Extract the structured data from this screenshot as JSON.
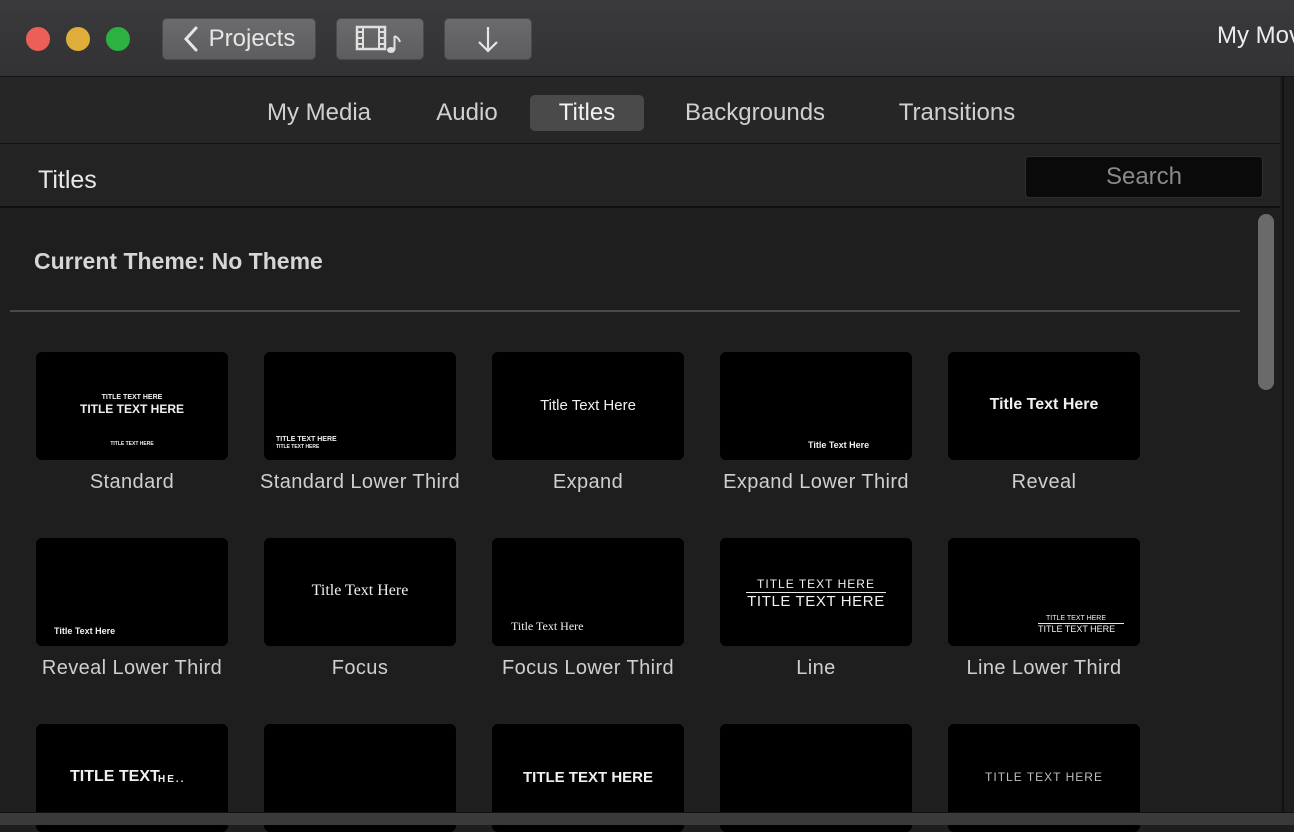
{
  "window": {
    "title": "My Mov"
  },
  "toolbar": {
    "projects_label": "Projects",
    "media_button_icon": "film-music-icon",
    "import_button_icon": "down-arrow-icon"
  },
  "tabs": [
    {
      "label": "My Media"
    },
    {
      "label": "Audio"
    },
    {
      "label": "Titles",
      "active": true
    },
    {
      "label": "Backgrounds"
    },
    {
      "label": "Transitions"
    }
  ],
  "section": {
    "title": "Titles",
    "search_placeholder": "Search"
  },
  "theme": {
    "label": "Current Theme: No Theme"
  },
  "tiles": [
    {
      "label": "Standard",
      "preview": [
        "TITLE TEXT HERE",
        "TITLE TEXT HERE",
        "TITLE TEXT HERE"
      ]
    },
    {
      "label": "Standard Lower Third",
      "preview": [
        "TITLE TEXT HERE",
        "TITLE TEXT HERE"
      ]
    },
    {
      "label": "Expand",
      "preview": [
        "Title Text Here"
      ]
    },
    {
      "label": "Expand Lower Third",
      "preview": [
        "Title Text Here"
      ]
    },
    {
      "label": "Reveal",
      "preview": [
        "Title Text Here"
      ]
    },
    {
      "label": "Reveal Lower Third",
      "preview": [
        "Title Text Here"
      ]
    },
    {
      "label": "Focus",
      "preview": [
        "Title Text Here"
      ]
    },
    {
      "label": "Focus Lower Third",
      "preview": [
        "Title Text Here"
      ]
    },
    {
      "label": "Line",
      "preview": [
        "TITLE TEXT HERE",
        "TITLE TEXT HERE"
      ]
    },
    {
      "label": "Line Lower Third",
      "preview": [
        "TITLE TEXT HERE",
        "TITLE TEXT HERE"
      ]
    },
    {
      "label": "",
      "preview": [
        "TITLE TEXT",
        "HE.."
      ]
    },
    {
      "label": "",
      "preview": []
    },
    {
      "label": "",
      "preview": [
        "TITLE TEXT HERE"
      ]
    },
    {
      "label": "",
      "preview": []
    },
    {
      "label": "",
      "preview": [
        "TITLE TEXT HERE"
      ]
    }
  ]
}
